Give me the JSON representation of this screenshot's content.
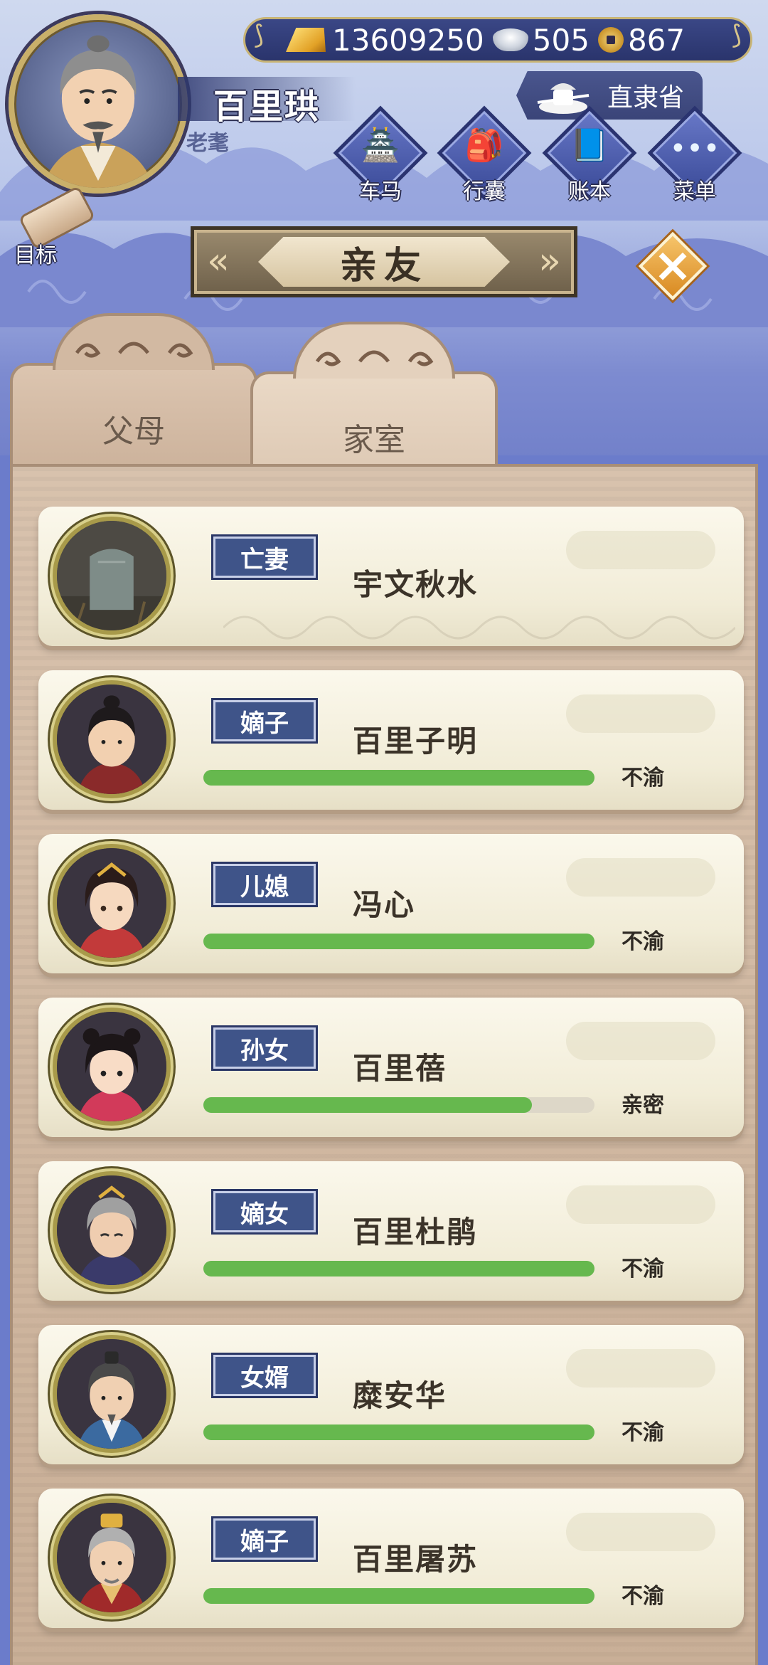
{
  "player": {
    "name": "百里珙",
    "title": "老耄"
  },
  "currency": {
    "gold": "13609250",
    "silver": "505",
    "copper": "867"
  },
  "location": {
    "province": "直隶省"
  },
  "menu": [
    {
      "label": "车马",
      "icon": "carriage-icon"
    },
    {
      "label": "行囊",
      "icon": "bag-icon"
    },
    {
      "label": "账本",
      "icon": "ledger-icon"
    },
    {
      "label": "菜单",
      "icon": "more-icon"
    }
  ],
  "goal": {
    "label": "目标",
    "icon": "scroll-icon"
  },
  "panel": {
    "title": "亲友",
    "close_icon": "close-icon"
  },
  "tabs": [
    {
      "label": "父母",
      "active": false
    },
    {
      "label": "家室",
      "active": true
    }
  ],
  "members": [
    {
      "relation": "亡妻",
      "name": "宇文秋水",
      "mood": "",
      "affinity": null,
      "portrait": "tombstone"
    },
    {
      "relation": "嫡子",
      "name": "百里子明",
      "mood": "不渝",
      "affinity": 1.0,
      "portrait": "young-man"
    },
    {
      "relation": "儿媳",
      "name": "冯心",
      "mood": "不渝",
      "affinity": 1.0,
      "portrait": "young-woman"
    },
    {
      "relation": "孙女",
      "name": "百里蓓",
      "mood": "亲密",
      "affinity": 0.84,
      "portrait": "girl"
    },
    {
      "relation": "嫡女",
      "name": "百里杜鹃",
      "mood": "不渝",
      "affinity": 1.0,
      "portrait": "old-woman"
    },
    {
      "relation": "女婿",
      "name": "糜安华",
      "mood": "不渝",
      "affinity": 1.0,
      "portrait": "middle-man"
    },
    {
      "relation": "嫡子",
      "name": "百里屠苏",
      "mood": "不渝",
      "affinity": 1.0,
      "portrait": "old-man"
    }
  ],
  "colors": {
    "bar_fill": "#66b84e",
    "badge_bg": "#3f5489",
    "card_bg": "#f6f2e2",
    "panel_bg": "#d8c2ad",
    "sky": "#6f7fc9"
  }
}
